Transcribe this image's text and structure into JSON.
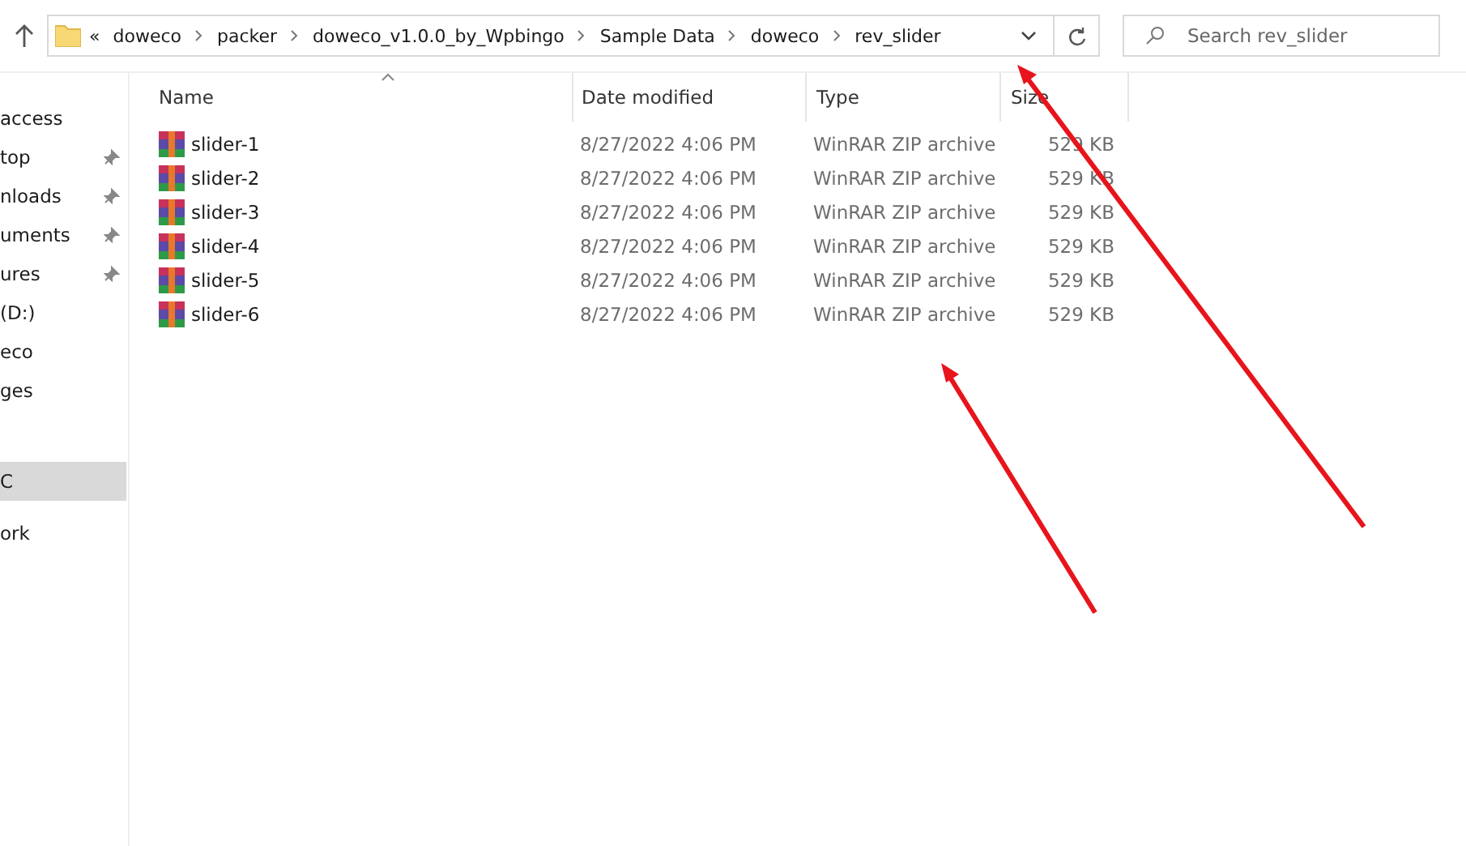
{
  "address_bar": {
    "prefix": "«",
    "path": [
      "doweco",
      "packer",
      "doweco_v1.0.0_by_Wpbingo",
      "Sample Data",
      "doweco",
      "rev_slider"
    ]
  },
  "search": {
    "placeholder": "Search rev_slider"
  },
  "sidebar": {
    "items": [
      {
        "label": "access",
        "pinned": false,
        "selected": false
      },
      {
        "label": "top",
        "pinned": true,
        "selected": false
      },
      {
        "label": "nloads",
        "pinned": true,
        "selected": false
      },
      {
        "label": "uments",
        "pinned": true,
        "selected": false
      },
      {
        "label": "ures",
        "pinned": true,
        "selected": false
      },
      {
        "label": "(D:)",
        "pinned": false,
        "selected": false
      },
      {
        "label": "eco",
        "pinned": false,
        "selected": false
      },
      {
        "label": "ges",
        "pinned": false,
        "selected": false
      },
      {
        "label": "C",
        "pinned": false,
        "selected": true
      },
      {
        "label": "ork",
        "pinned": false,
        "selected": false
      }
    ]
  },
  "table": {
    "columns": [
      "Name",
      "Date modified",
      "Type",
      "Size"
    ],
    "rows": [
      {
        "name": "slider-1",
        "date": "8/27/2022 4:06 PM",
        "type": "WinRAR ZIP archive",
        "size": "529 KB"
      },
      {
        "name": "slider-2",
        "date": "8/27/2022 4:06 PM",
        "type": "WinRAR ZIP archive",
        "size": "529 KB"
      },
      {
        "name": "slider-3",
        "date": "8/27/2022 4:06 PM",
        "type": "WinRAR ZIP archive",
        "size": "529 KB"
      },
      {
        "name": "slider-4",
        "date": "8/27/2022 4:06 PM",
        "type": "WinRAR ZIP archive",
        "size": "529 KB"
      },
      {
        "name": "slider-5",
        "date": "8/27/2022 4:06 PM",
        "type": "WinRAR ZIP archive",
        "size": "529 KB"
      },
      {
        "name": "slider-6",
        "date": "8/27/2022 4:06 PM",
        "type": "WinRAR ZIP archive",
        "size": "529 KB"
      }
    ]
  }
}
